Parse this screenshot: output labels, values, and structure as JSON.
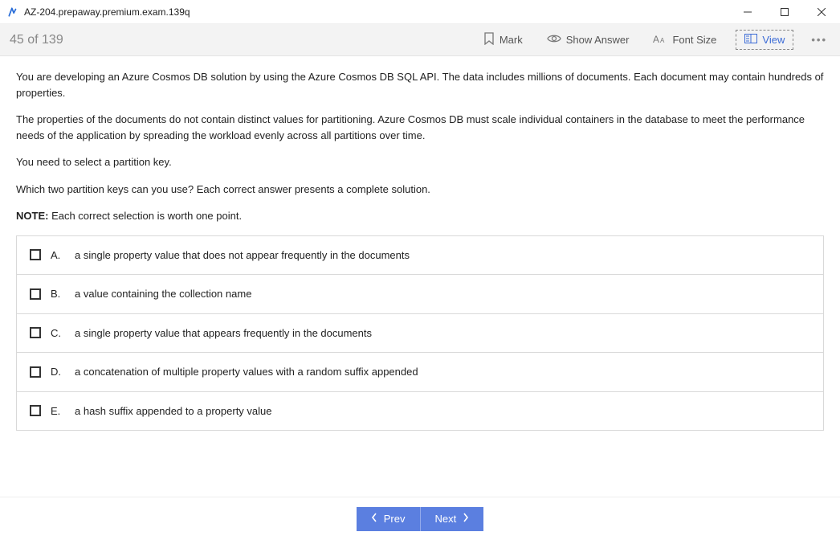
{
  "window": {
    "title": "AZ-204.prepaway.premium.exam.139q"
  },
  "toolbar": {
    "counter": "45 of 139",
    "mark": "Mark",
    "show_answer": "Show Answer",
    "font_size": "Font Size",
    "view": "View"
  },
  "question": {
    "p1": "You are developing an Azure Cosmos DB solution by using the Azure Cosmos DB SQL API. The data includes millions of documents. Each document may contain hundreds of properties.",
    "p2": "The properties of the documents do not contain distinct values for partitioning. Azure Cosmos DB must scale individual containers in the database to meet the performance needs of the application by spreading the workload evenly across all partitions over time.",
    "p3": "You need to select a partition key.",
    "p4": "Which two partition keys can you use? Each correct answer presents a complete solution.",
    "note_label": "NOTE:",
    "note_text": " Each correct selection is worth one point."
  },
  "options": [
    {
      "letter": "A.",
      "text": "a single property value that does not appear frequently in the documents"
    },
    {
      "letter": "B.",
      "text": "a value containing the collection name"
    },
    {
      "letter": "C.",
      "text": "a single property value that appears frequently in the documents"
    },
    {
      "letter": "D.",
      "text": "a concatenation of multiple property values with a random suffix appended"
    },
    {
      "letter": "E.",
      "text": "a hash suffix appended to a property value"
    }
  ],
  "nav": {
    "prev": "Prev",
    "next": "Next"
  }
}
